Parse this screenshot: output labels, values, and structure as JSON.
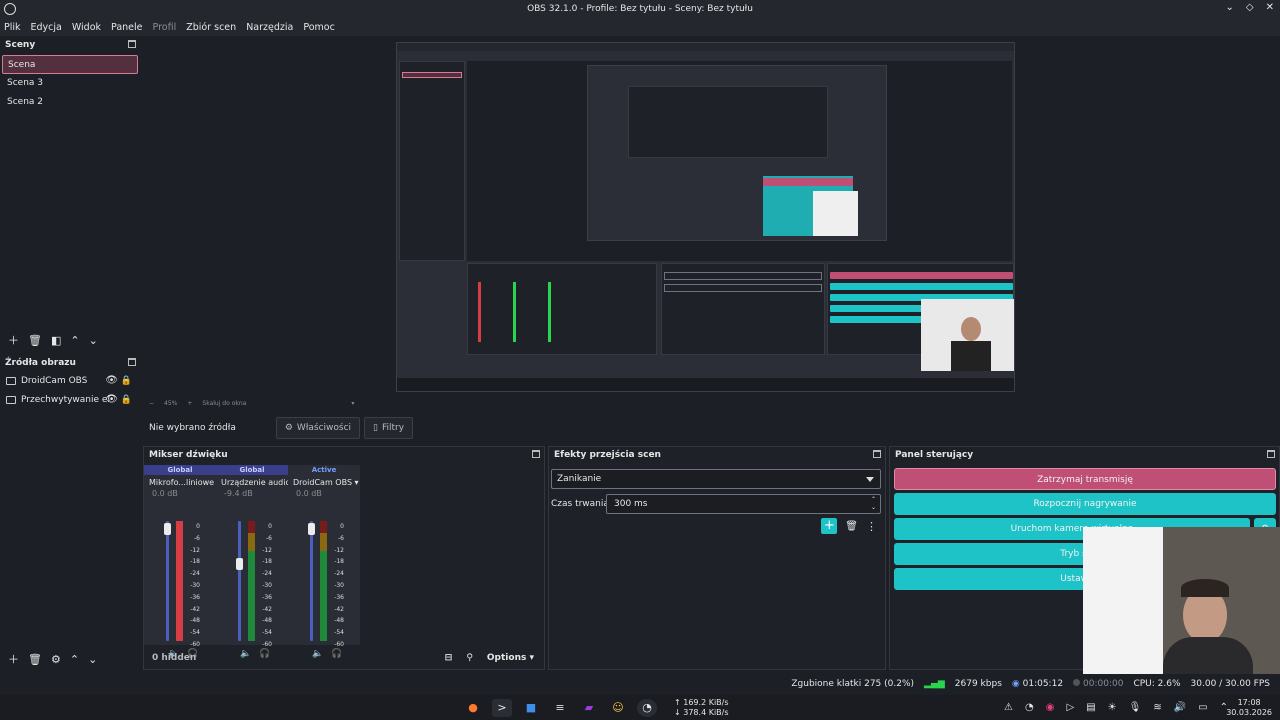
{
  "window": {
    "title": "OBS 32.1.0 - Profile: Bez tytułu - Sceny: Bez tytułu"
  },
  "menu": [
    "Plik",
    "Edycja",
    "Widok",
    "Panele",
    "Profil",
    "Zbiór scen",
    "Narzędzia",
    "Pomoc"
  ],
  "scenes": {
    "title": "Sceny",
    "items": [
      "Scena",
      "Scena 3",
      "Scena 2"
    ]
  },
  "sources": {
    "title": "Źródła obrazu",
    "items": [
      "DroidCam OBS",
      "Przechwytywanie el"
    ]
  },
  "preview": {
    "zoom": "45%",
    "scale_label": "Skaluj do okna"
  },
  "context": {
    "no_source": "Nie wybrano źródła",
    "properties": "Właściwości",
    "filters": "Filtry"
  },
  "mixer": {
    "title": "Mikser dźwięku",
    "channels": [
      {
        "type": "Global",
        "name": "Mikrofo...liniowe",
        "db": "0.0 dB",
        "level": 1.0
      },
      {
        "type": "Global",
        "name": "Urządzenie audio",
        "db": "-9.4 dB",
        "level": 0.72
      },
      {
        "type": "Active",
        "name": "DroidCam OBS",
        "db": "0.0 dB",
        "level": 1.0
      }
    ],
    "scale": [
      "0",
      "-6",
      "-12",
      "-18",
      "-24",
      "-30",
      "-36",
      "-42",
      "-48",
      "-54",
      "-60"
    ],
    "hidden": "0 hidden",
    "options": "Options"
  },
  "transitions": {
    "title": "Efekty przejścia scen",
    "selected": "Zanikanie",
    "duration_label": "Czas trwania",
    "duration": "300 ms"
  },
  "controls": {
    "title": "Panel sterujący",
    "buttons": [
      "Zatrzymaj transmisję",
      "Rozpocznij nagrywanie",
      "Uruchom kamerę wirtualną",
      "Tryb studia",
      "Ustawienia"
    ]
  },
  "status": {
    "dropped": "Zgubione klatki 275 (0.2%)",
    "bitrate": "2679 kbps",
    "stream_time": "01:05:12",
    "rec_time": "00:00:00",
    "cpu": "CPU: 2.6%",
    "fps": "30.00 / 30.00 FPS"
  },
  "taskbar": {
    "net_up": "169.2 KiB/s",
    "net_down": "378.4 KiB/s",
    "time": "17:08",
    "date": "30.03.2026"
  },
  "colors": {
    "accent_pink": "#bf4f74",
    "accent_cyan": "#1ec3c8",
    "bg": "#1d1f26"
  }
}
